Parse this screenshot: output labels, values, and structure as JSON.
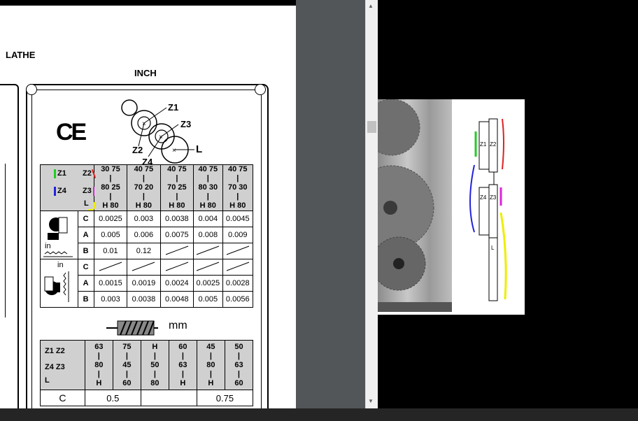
{
  "document": {
    "heading_lathe": "LATHE",
    "heading_inch": "INCH",
    "ce_mark": "CE",
    "mm_label": "mm"
  },
  "gear_diagram": {
    "z1": "Z1",
    "z2": "Z2",
    "z3": "Z3",
    "z4": "Z4",
    "l": "L"
  },
  "inch_table": {
    "header_labels": {
      "z1": "Z1",
      "z2": "Z2",
      "z4": "Z4",
      "z3": "Z3",
      "l": "L"
    },
    "columns": [
      {
        "top": "30 75",
        "mid": "80 25",
        "bot": "H 80"
      },
      {
        "top": "40 75",
        "mid": "70 20",
        "bot": "H 80"
      },
      {
        "top": "40 75",
        "mid": "70 25",
        "bot": "H 80"
      },
      {
        "top": "40 75",
        "mid": "80 30",
        "bot": "H 80"
      },
      {
        "top": "40 75",
        "mid": "70 30",
        "bot": "H 80"
      }
    ],
    "rows": [
      {
        "label": "C",
        "values": [
          "0.0025",
          "0.003",
          "0.0038",
          "0.004",
          "0.0045"
        ]
      },
      {
        "label": "A",
        "values": [
          "0.005",
          "0.006",
          "0.0075",
          "0.008",
          "0.009"
        ]
      },
      {
        "label": "B",
        "values": [
          "0.01",
          "0.12",
          "",
          "",
          ""
        ]
      },
      {
        "label": "C",
        "values": [
          "",
          "",
          "",
          "",
          ""
        ]
      },
      {
        "label": "A",
        "values": [
          "0.0015",
          "0.0019",
          "0.0024",
          "0.0025",
          "0.0028"
        ]
      },
      {
        "label": "B",
        "values": [
          "0.003",
          "0.0038",
          "0.0048",
          "0.005",
          "0.0056"
        ]
      }
    ],
    "in_label": "in"
  },
  "mm_table": {
    "header_labels": {
      "z1z2": "Z1 Z2",
      "z4z3": "Z4 Z3",
      "l": "L"
    },
    "columns": [
      {
        "top": "63",
        "mid": "80",
        "bot": "H"
      },
      {
        "top": "75",
        "mid": "45",
        "bot": "60"
      },
      {
        "top": "H",
        "mid": "50",
        "bot": "80"
      },
      {
        "top": "60",
        "mid": "63",
        "bot": "H"
      },
      {
        "top": "45",
        "mid": "80",
        "bot": "H"
      },
      {
        "top": "50",
        "mid": "63",
        "bot": "60"
      }
    ],
    "row_c": {
      "label": "C",
      "v1": "0.5",
      "v2": "0.75"
    }
  },
  "right_image": {
    "labels": {
      "z1": "Z1",
      "z2": "Z2",
      "z4": "Z4",
      "z3": "Z3",
      "l": "L"
    }
  },
  "colors": {
    "green": "#22cc22",
    "red": "#dd2222",
    "blue": "#2222dd",
    "magenta": "#dd22dd",
    "yellow": "#eeee00"
  }
}
